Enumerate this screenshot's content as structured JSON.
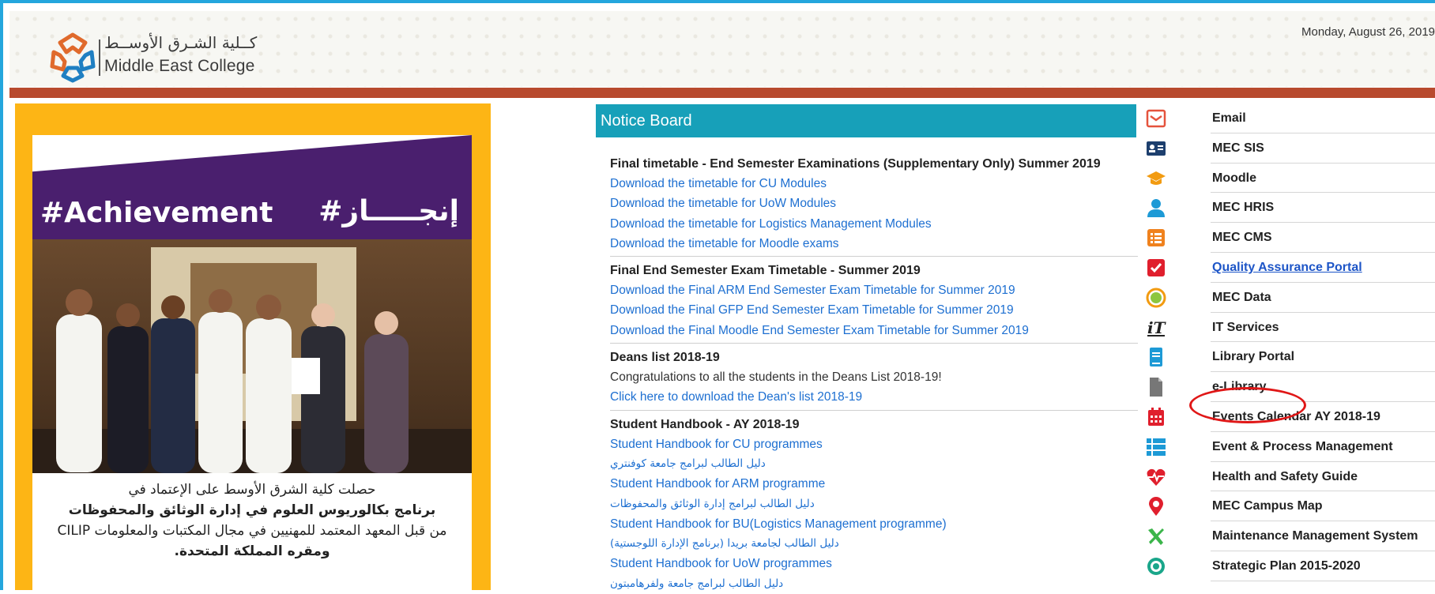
{
  "header": {
    "logo_arabic": "كــلية الشـرق الأوســط",
    "logo_english": "Middle East College",
    "date": "Monday, August 26, 2019"
  },
  "poster": {
    "hashtag_en": "#Achievement",
    "hashtag_ar": "#إنجـــــاز",
    "line1": "حصلت كلية الشرق الأوسط على الإعتماد في",
    "line2": "برنامج بكالوريوس العلوم في إدارة الوثائق والمحفوظات",
    "line3": "من قبل المعهد المعتمد للمهنيين في مجال المكتبات والمعلومات  CILIP",
    "line4": "ومقره المملكة المتحدة."
  },
  "notice_board": {
    "title": "Notice Board",
    "sections": [
      {
        "heading": "Final timetable - End Semester Examinations (Supplementary Only) Summer 2019",
        "items": [
          "Download the timetable for CU Modules",
          "Download the timetable for UoW Modules",
          "Download the timetable for Logistics Management Modules",
          "Download the timetable for Moodle exams"
        ]
      },
      {
        "heading": "Final End Semester Exam Timetable - Summer 2019",
        "items": [
          "Download the Final ARM End Semester Exam Timetable for Summer 2019",
          "Download the Final GFP End Semester Exam Timetable for Summer 2019",
          "Download the Final Moodle End Semester Exam Timetable for Summer 2019"
        ]
      },
      {
        "heading": "Deans list 2018-19",
        "text": "Congratulations to all the students in the Deans List 2018-19!",
        "items": [
          "Click here to download the Dean's list 2018-19"
        ]
      },
      {
        "heading": "Student Handbook - AY 2018-19",
        "items": [
          "Student Handbook for CU programmes",
          "دليل الطالب لبرامج جامعة كوفنتري",
          "Student Handbook for ARM programme",
          "دليل الطالب لبرامج إدارة الوثائق والمحفوظات",
          "Student Handbook for BU(Logistics Management programme)",
          "(دليل الطالب لجامعة بريدا (برنامج الإدارة اللوجستية",
          "Student Handbook for UoW programmes",
          "دليل الطالب لبرامج جامعة ولفرهامبتون"
        ]
      }
    ]
  },
  "quick_links": [
    {
      "label": "Email",
      "icon": "envelope-icon",
      "color": "#e5533d"
    },
    {
      "label": "MEC SIS",
      "icon": "id-card-icon",
      "color": "#1d3f6e"
    },
    {
      "label": "Moodle",
      "icon": "graduation-cap-icon",
      "color": "#f29b11"
    },
    {
      "label": "MEC HRIS",
      "icon": "user-icon",
      "color": "#1d9ad6"
    },
    {
      "label": "MEC CMS",
      "icon": "list-icon",
      "color": "#f0821e"
    },
    {
      "label": "Quality Assurance Portal",
      "icon": "check-square-icon",
      "color": "#e01f2d"
    },
    {
      "label": "MEC Data",
      "icon": "circle-target-icon",
      "color": "#f29b11"
    },
    {
      "label": "IT Services",
      "icon": "it-logo-icon",
      "color": "#222222"
    },
    {
      "label": "Library Portal",
      "icon": "book-icon",
      "color": "#1d9ad6"
    },
    {
      "label": "e-Library",
      "icon": "file-icon",
      "color": "#777777"
    },
    {
      "label": "Events Calendar AY 2018-19",
      "icon": "calendar-icon",
      "color": "#e01f2d"
    },
    {
      "label": "Event & Process Management",
      "icon": "task-list-icon",
      "color": "#1d9ad6"
    },
    {
      "label": "Health and Safety Guide",
      "icon": "heartbeat-icon",
      "color": "#e01f2d"
    },
    {
      "label": "MEC Campus Map",
      "icon": "map-marker-icon",
      "color": "#e01f2d"
    },
    {
      "label": "Maintenance Management System",
      "icon": "tools-icon",
      "color": "#3bb54a"
    },
    {
      "label": "Strategic Plan 2015-2020",
      "icon": "target-icon",
      "color": "#1aa68a"
    }
  ]
}
